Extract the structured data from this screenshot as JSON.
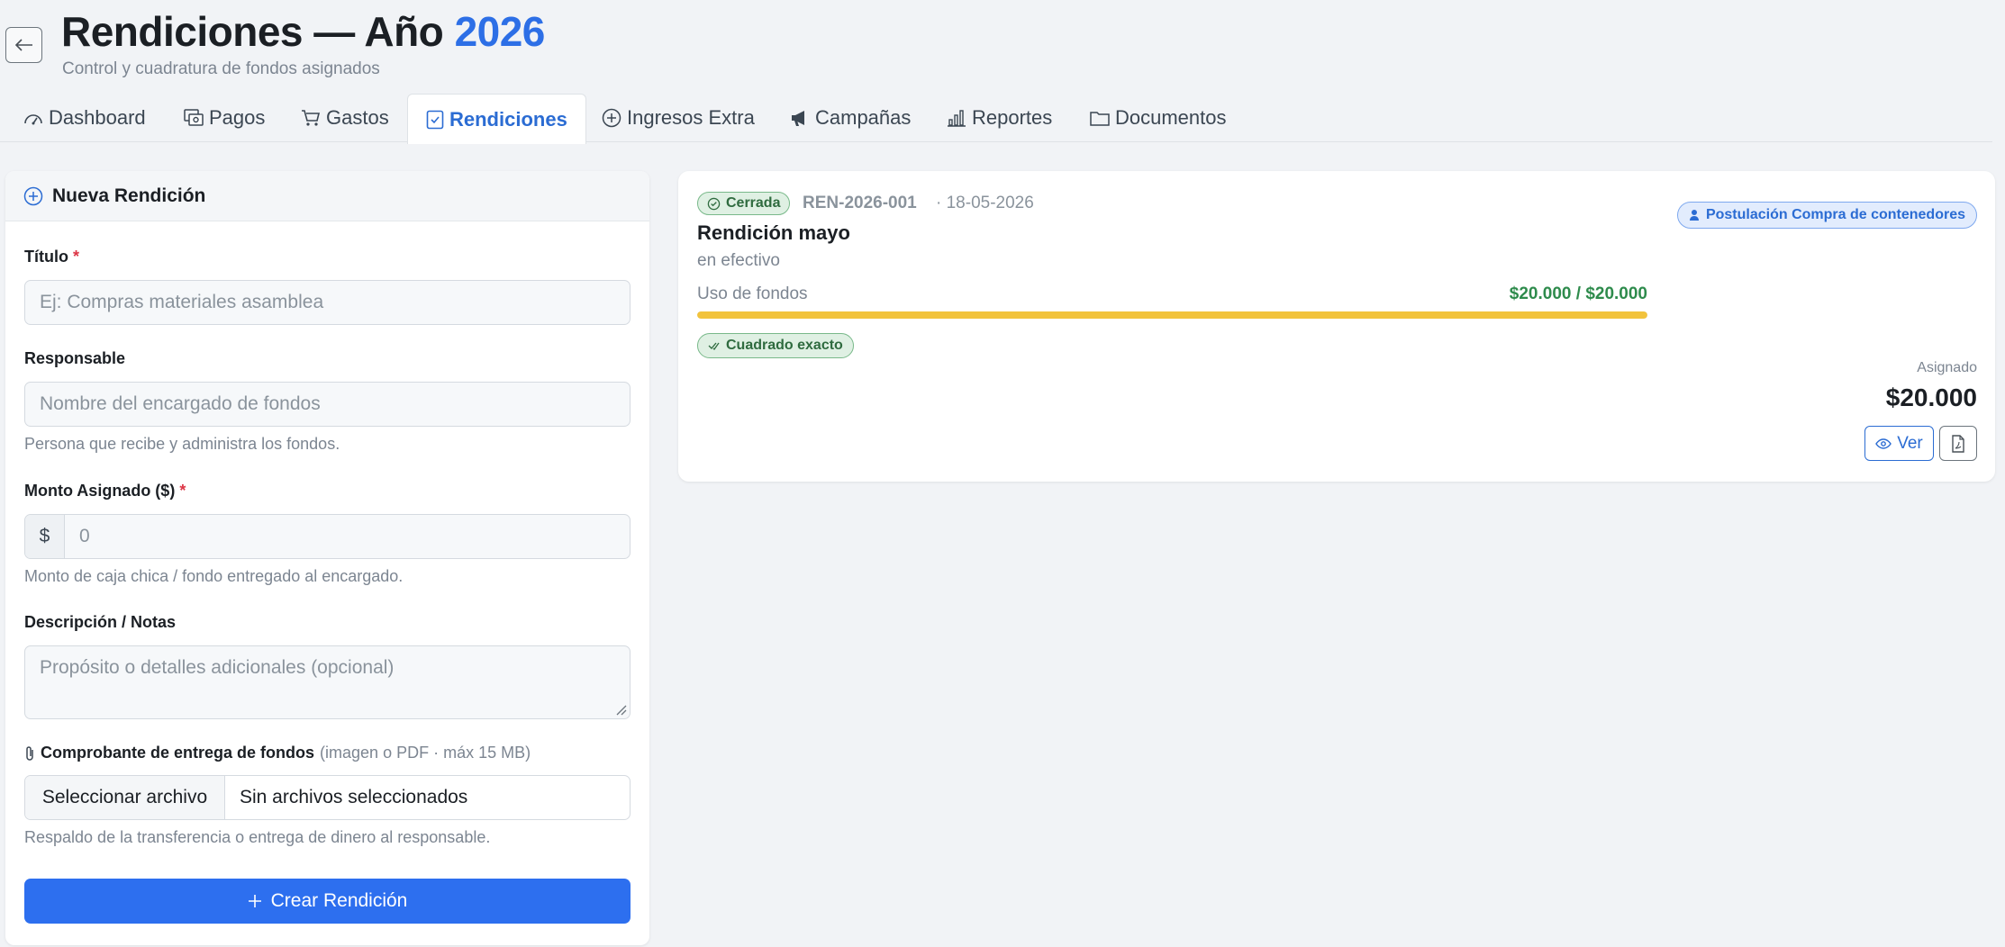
{
  "header": {
    "title": "Rendiciones — Año",
    "year": "2026",
    "subtitle": "Control y cuadratura de fondos asignados"
  },
  "tabs": [
    {
      "label": "Dashboard",
      "icon": "gauge-icon"
    },
    {
      "label": "Pagos",
      "icon": "cash-icon"
    },
    {
      "label": "Gastos",
      "icon": "cart-icon"
    },
    {
      "label": "Rendiciones",
      "icon": "clipboard-check-icon",
      "active": true
    },
    {
      "label": "Ingresos Extra",
      "icon": "plus-circle-icon"
    },
    {
      "label": "Campañas",
      "icon": "megaphone-icon"
    },
    {
      "label": "Reportes",
      "icon": "bar-chart-icon"
    },
    {
      "label": "Documentos",
      "icon": "folder-icon"
    }
  ],
  "form": {
    "heading": "Nueva Rendición",
    "title_label": "Título",
    "title_placeholder": "Ej: Compras materiales asamblea",
    "responsable_label": "Responsable",
    "responsable_placeholder": "Nombre del encargado de fondos",
    "responsable_help": "Persona que recibe y administra los fondos.",
    "monto_label": "Monto Asignado ($)",
    "monto_prefix": "$",
    "monto_placeholder": "0",
    "monto_help": "Monto de caja chica / fondo entregado al encargado.",
    "descripcion_label": "Descripción / Notas",
    "descripcion_placeholder": "Propósito o detalles adicionales (opcional)",
    "comprobante_label": "Comprobante de entrega de fondos",
    "comprobante_hint": "(imagen o PDF · máx 15 MB)",
    "file_button": "Seleccionar archivo",
    "file_status": "Sin archivos seleccionados",
    "comprobante_help": "Respaldo de la transferencia o entrega de dinero al responsable.",
    "submit_label": "Crear Rendición",
    "required_mark": "*"
  },
  "rendicion": {
    "status": "Cerrada",
    "code": "REN-2026-001",
    "date": "· 18-05-2026",
    "name": "Rendición mayo",
    "description": "en efectivo",
    "usage_label": "Uso de fondos",
    "usage_value": "$20.000 / $20.000",
    "usage_fraction": 1.0,
    "balance_badge": "Cuadrado exacto",
    "campaign": "Postulación Compra de contenedores",
    "assigned_label": "Asignado",
    "assigned_value": "$20.000",
    "view_label": "Ver"
  },
  "colors": {
    "accent": "#2d6fe6",
    "success": "#2e8b4c",
    "progress": "#f2c33c"
  }
}
